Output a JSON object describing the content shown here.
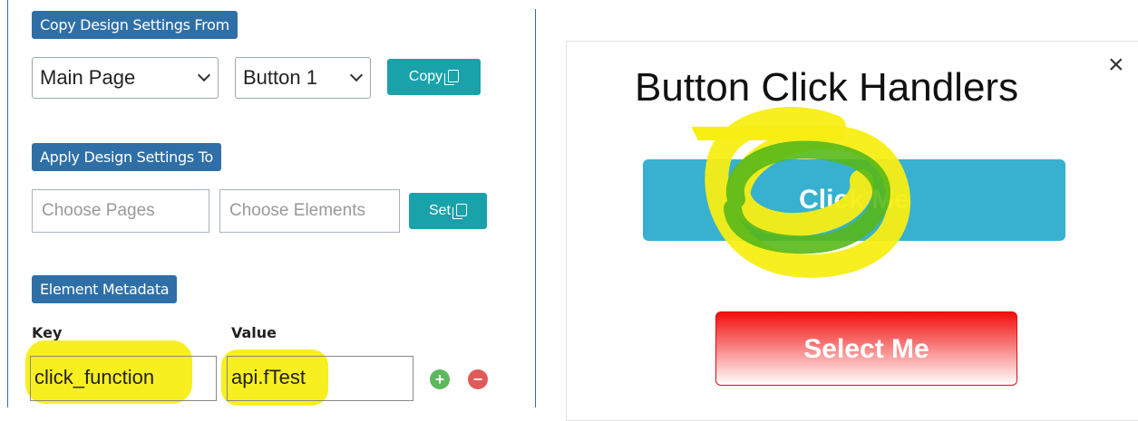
{
  "left_panel": {
    "copy_section": {
      "label": "Copy Design Settings From",
      "page_select": "Main Page",
      "element_select": "Button 1",
      "copy_button": "Copy"
    },
    "apply_section": {
      "label": "Apply Design Settings To",
      "pages_placeholder": "Choose Pages",
      "elements_placeholder": "Choose Elements",
      "set_button": "Set"
    },
    "metadata_section": {
      "label": "Element Metadata",
      "key_header": "Key",
      "value_header": "Value",
      "key_value": "click_function",
      "value_value": "api.fTest"
    }
  },
  "preview": {
    "title": "Button Click Handlers",
    "close_symbol": "×",
    "primary_button": "Click Me",
    "secondary_button": "Select Me"
  },
  "colors": {
    "label_blue": "#2f6fa8",
    "teal_button": "#1aa2aa",
    "click_button": "#37b1cf",
    "select_button_red": "#f20d0d",
    "highlight_yellow": "#f7ee14",
    "annotation_green": "#58b818",
    "add_icon_green": "#5cb85c",
    "remove_icon_red": "#e05a5a"
  }
}
